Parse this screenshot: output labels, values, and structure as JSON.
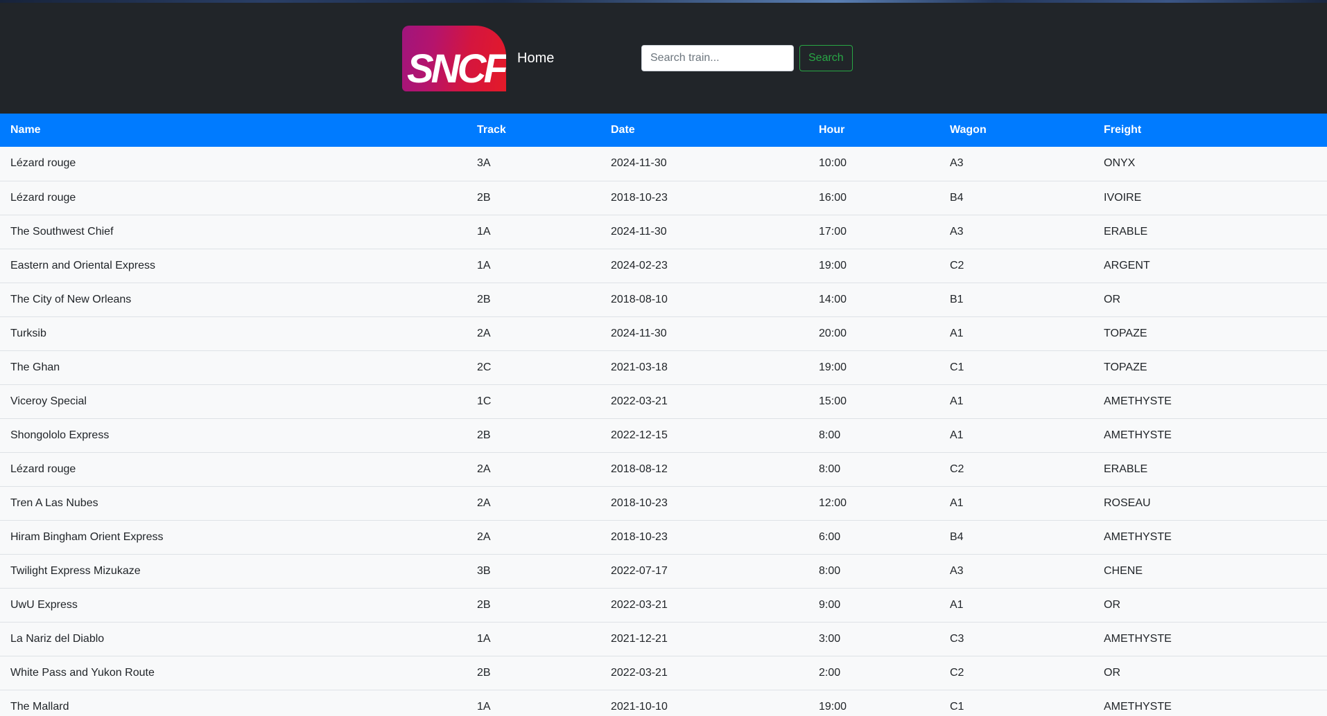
{
  "header": {
    "logo_text": "SNCF",
    "home_label": "Home",
    "search_placeholder": "Search train...",
    "search_button": "Search"
  },
  "colors": {
    "navbar": "#212529",
    "table_header": "#007bff",
    "search_button": "#28a745",
    "logo_gradient_start": "#a0157d",
    "logo_gradient_end": "#e41a28"
  },
  "table": {
    "columns": [
      "Name",
      "Track",
      "Date",
      "Hour",
      "Wagon",
      "Freight"
    ],
    "rows": [
      [
        "Lézard rouge",
        "3A",
        "2024-11-30",
        "10:00",
        "A3",
        "ONYX"
      ],
      [
        "Lézard rouge",
        "2B",
        "2018-10-23",
        "16:00",
        "B4",
        "IVOIRE"
      ],
      [
        "The Southwest Chief",
        "1A",
        "2024-11-30",
        "17:00",
        "A3",
        "ERABLE"
      ],
      [
        "Eastern and Oriental Express",
        "1A",
        "2024-02-23",
        "19:00",
        "C2",
        "ARGENT"
      ],
      [
        "The City of New Orleans",
        "2B",
        "2018-08-10",
        "14:00",
        "B1",
        "OR"
      ],
      [
        "Turksib",
        "2A",
        "2024-11-30",
        "20:00",
        "A1",
        "TOPAZE"
      ],
      [
        "The Ghan",
        "2C",
        "2021-03-18",
        "19:00",
        "C1",
        "TOPAZE"
      ],
      [
        "Viceroy Special",
        "1C",
        "2022-03-21",
        "15:00",
        "A1",
        "AMETHYSTE"
      ],
      [
        "Shongololo Express",
        "2B",
        "2022-12-15",
        "8:00",
        "A1",
        "AMETHYSTE"
      ],
      [
        "Lézard rouge",
        "2A",
        "2018-08-12",
        "8:00",
        "C2",
        "ERABLE"
      ],
      [
        "Tren A Las Nubes",
        "2A",
        "2018-10-23",
        "12:00",
        "A1",
        "ROSEAU"
      ],
      [
        "Hiram Bingham Orient Express",
        "2A",
        "2018-10-23",
        "6:00",
        "B4",
        "AMETHYSTE"
      ],
      [
        "Twilight Express Mizukaze",
        "3B",
        "2022-07-17",
        "8:00",
        "A3",
        "CHENE"
      ],
      [
        "UwU Express",
        "2B",
        "2022-03-21",
        "9:00",
        "A1",
        "OR"
      ],
      [
        "La Nariz del Diablo",
        "1A",
        "2021-12-21",
        "3:00",
        "C3",
        "AMETHYSTE"
      ],
      [
        "White Pass and Yukon Route",
        "2B",
        "2022-03-21",
        "2:00",
        "C2",
        "OR"
      ],
      [
        "The Mallard",
        "1A",
        "2021-10-10",
        "19:00",
        "C1",
        "AMETHYSTE"
      ]
    ]
  }
}
